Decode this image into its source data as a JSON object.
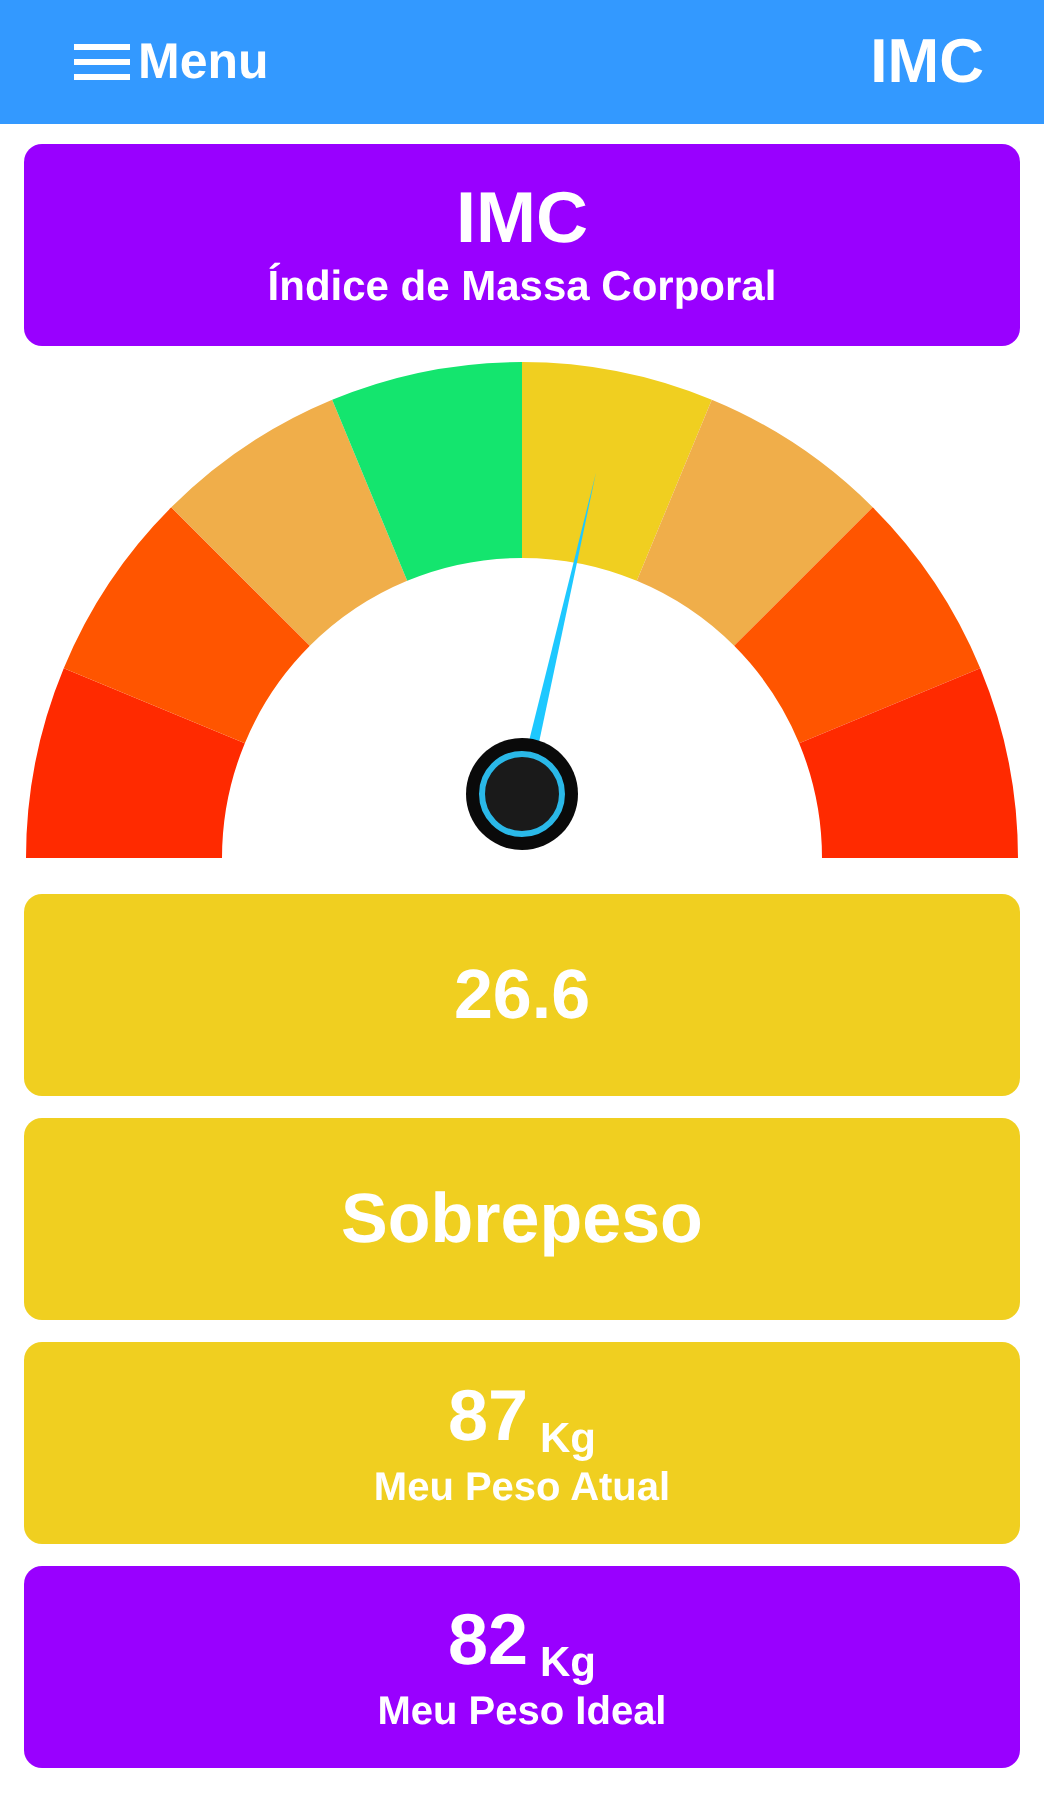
{
  "app_bar": {
    "menu_label": "Menu",
    "title": "IMC"
  },
  "header_card": {
    "title": "IMC",
    "subtitle": "Índice de Massa Corporal",
    "color": "#9900ff"
  },
  "gauge": {
    "level": 0.572,
    "segments": [
      {
        "color": "#ff2a00"
      },
      {
        "color": "#ff5500"
      },
      {
        "color": "#f0ae4a"
      },
      {
        "color": "#14e56e"
      },
      {
        "color": "#f0cf20"
      },
      {
        "color": "#f0ae4a"
      },
      {
        "color": "#ff5500"
      },
      {
        "color": "#ff2a00"
      }
    ]
  },
  "cards": [
    {
      "kind": "value",
      "value": "26.6",
      "color": "#f0cf20"
    },
    {
      "kind": "value",
      "value": "Sobrepeso",
      "color": "#f0cf20"
    },
    {
      "kind": "weight",
      "value": "87",
      "unit": "Kg",
      "label": "Meu Peso Atual",
      "color": "#f0cf20"
    },
    {
      "kind": "weight",
      "value": "82",
      "unit": "Kg",
      "label": "Meu Peso Ideal",
      "color": "#9900ff"
    }
  ]
}
